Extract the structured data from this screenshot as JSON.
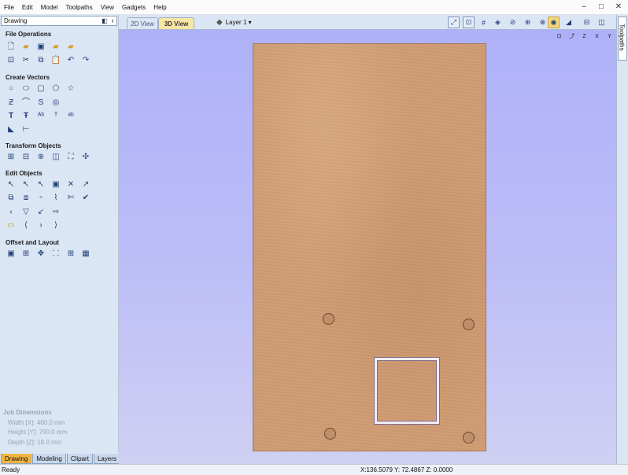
{
  "menu": [
    "File",
    "Edit",
    "Model",
    "Toolpaths",
    "View",
    "Gadgets",
    "Help"
  ],
  "window_controls": {
    "minimize": "–",
    "maximize": "□",
    "close": "✕"
  },
  "left_panel": {
    "title": "Drawing",
    "sections": {
      "file_operations": "File Operations",
      "create_vectors": "Create Vectors",
      "transform_objects": "Transform Objects",
      "edit_objects": "Edit Objects",
      "offset_and_layout": "Offset and Layout"
    },
    "job_dimensions": {
      "title": "Job Dimensions",
      "width": "Width  [X]: 400.0 mm",
      "height": "Height [Y]: 700.0 mm",
      "depth": "Depth  [Z]: 18.0 mm"
    },
    "tabs": [
      "Drawing",
      "Modeling",
      "Clipart",
      "Layers"
    ],
    "active_tab": "Drawing"
  },
  "view": {
    "tabs": [
      "2D View",
      "3D View"
    ],
    "active_tab": "3D View",
    "layer": "Layer 1 ▾",
    "view_axis_labels": [
      "Z",
      "X",
      "Y"
    ]
  },
  "right_strip": {
    "label": "Toolpaths"
  },
  "status": {
    "left": "Ready",
    "coords": "X:136.5079 Y: 72.4867 Z:  0.0000"
  },
  "colors": {
    "panel_bg": "#dbe6f4",
    "view_bg": "#b3b5f7",
    "material": "#cf9b72",
    "active_tab": "#f2b441"
  }
}
